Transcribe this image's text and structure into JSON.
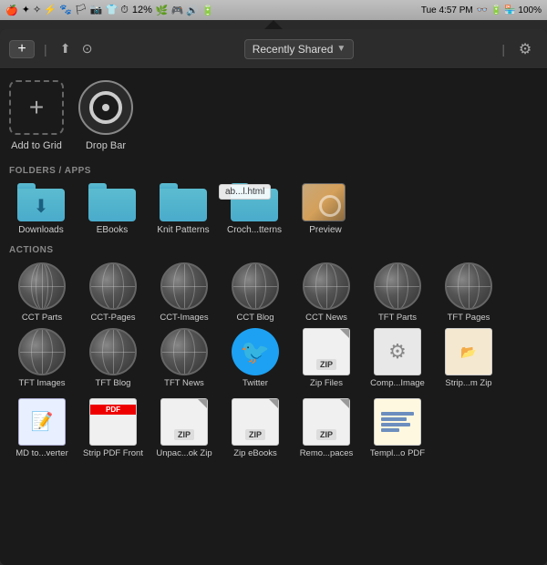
{
  "menubar": {
    "time": "Tue 4:57 PM",
    "battery": "100%",
    "percent": "12%"
  },
  "toolbar": {
    "add_label": "+",
    "dropdown_label": "Recently Shared",
    "dropdown_arrow": "▼",
    "gear_label": "⚙"
  },
  "add_to_grid": {
    "icon": "+",
    "label": "Add to Grid"
  },
  "drop_bar": {
    "label": "Drop Bar"
  },
  "sections": {
    "folders_label": "FOLDERS / APPS",
    "actions_label": "ACTIONS"
  },
  "folders": [
    {
      "label": "Downloads",
      "type": "download"
    },
    {
      "label": "EBooks",
      "type": "folder"
    },
    {
      "label": "Knit Patterns",
      "type": "folder"
    },
    {
      "label": "Croch...tterns",
      "type": "folder"
    },
    {
      "label": "Preview",
      "type": "preview"
    }
  ],
  "tooltip": "ab...l.html",
  "actions": [
    {
      "label": "CCT Parts",
      "type": "globe"
    },
    {
      "label": "CCT-Pages",
      "type": "globe"
    },
    {
      "label": "CCT-Images",
      "type": "globe"
    },
    {
      "label": "CCT Blog",
      "type": "globe"
    },
    {
      "label": "CCT News",
      "type": "globe"
    },
    {
      "label": "TFT Parts",
      "type": "globe"
    },
    {
      "label": "TFT Pages",
      "type": "globe"
    },
    {
      "label": "TFT Images",
      "type": "globe"
    },
    {
      "label": "TFT Blog",
      "type": "globe"
    },
    {
      "label": "TFT News",
      "type": "globe"
    },
    {
      "label": "Twitter",
      "type": "twitter"
    },
    {
      "label": "Zip Files",
      "type": "zip"
    },
    {
      "label": "Comp...Image",
      "type": "compress"
    },
    {
      "label": "Strip...m Zip",
      "type": "strip"
    }
  ],
  "bottom_actions": [
    {
      "label": "MD to...verter",
      "type": "md"
    },
    {
      "label": "Strip PDF Front",
      "type": "pdf"
    },
    {
      "label": "Unpac...ok Zip",
      "type": "zip2"
    },
    {
      "label": "Zip eBooks",
      "type": "zip2"
    },
    {
      "label": "Remo...paces",
      "type": "zip2"
    },
    {
      "label": "Templ...o PDF",
      "type": "tmpl"
    }
  ]
}
